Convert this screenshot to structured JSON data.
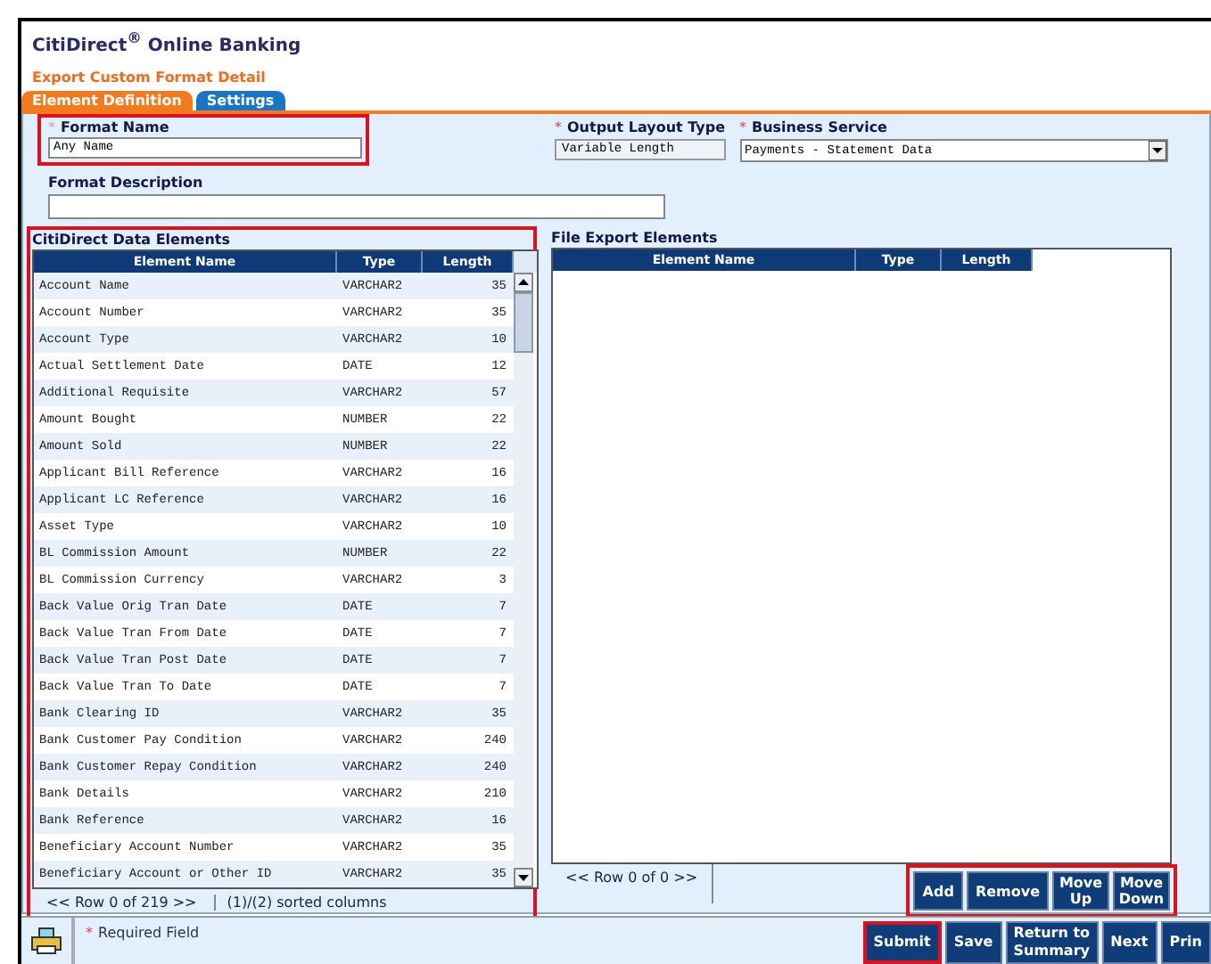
{
  "app_title": "CitiDirect$^{®}$ Online Banking",
  "page_title": "Export Custom Format Detail",
  "tabs": [
    {
      "label": "Element Definition",
      "selected": true
    },
    {
      "label": "Settings",
      "selected": false
    }
  ],
  "format_name": {
    "label": "Format Name",
    "required_mark": "*",
    "value": "Any Name",
    "highlighted": true
  },
  "output_layout_type": {
    "label": "Output Layout Type",
    "required_mark": "*",
    "value": "Variable Length"
  },
  "business_service": {
    "label": "Business Service",
    "required_mark": "*",
    "value": "Payments - Statement Data"
  },
  "format_description": {
    "label": "Format Description"
  },
  "data_elements": {
    "title": "CitiDirect Data Elements",
    "highlighted": true,
    "columns": [
      "Element Name",
      "Type",
      "Length"
    ],
    "rows": [
      [
        "Account Name",
        "VARCHAR2",
        "35"
      ],
      [
        "Account Number",
        "VARCHAR2",
        "35"
      ],
      [
        "Account Type",
        "VARCHAR2",
        "10"
      ],
      [
        "Actual Settlement Date",
        "DATE",
        "12"
      ],
      [
        "Additional Requisite",
        "VARCHAR2",
        "57"
      ],
      [
        "Amount Bought",
        "NUMBER",
        "22"
      ],
      [
        "Amount Sold",
        "NUMBER",
        "22"
      ],
      [
        "Applicant Bill Reference",
        "VARCHAR2",
        "16"
      ],
      [
        "Applicant LC Reference",
        "VARCHAR2",
        "16"
      ],
      [
        "Asset Type",
        "VARCHAR2",
        "10"
      ],
      [
        "BL Commission Amount",
        "NUMBER",
        "22"
      ],
      [
        "BL Commission Currency",
        "VARCHAR2",
        "3"
      ],
      [
        "Back Value Orig Tran Date",
        "DATE",
        "7"
      ],
      [
        "Back Value Tran From Date",
        "DATE",
        "7"
      ],
      [
        "Back Value Tran Post Date",
        "DATE",
        "7"
      ],
      [
        "Back Value Tran To Date",
        "DATE",
        "7"
      ],
      [
        "Bank Clearing ID",
        "VARCHAR2",
        "35"
      ],
      [
        "Bank Customer Pay Condition",
        "VARCHAR2",
        "240"
      ],
      [
        "Bank Customer Repay Condition",
        "VARCHAR2",
        "240"
      ],
      [
        "Bank Details",
        "VARCHAR2",
        "210"
      ],
      [
        "Bank Reference",
        "VARCHAR2",
        "16"
      ],
      [
        "Beneficiary Account Number",
        "VARCHAR2",
        "35"
      ],
      [
        "Beneficiary Account or Other ID",
        "VARCHAR2",
        "35"
      ]
    ],
    "pager": "<< Row 0 of 219 >>",
    "sort_info": "(1)/(2) sorted columns"
  },
  "export_elements": {
    "title": "File Export Elements",
    "columns": [
      "Element Name",
      "Type",
      "Length"
    ],
    "pager": "<< Row 0 of 0 >>",
    "buttons": {
      "highlighted": true,
      "items": [
        {
          "label": "Add"
        },
        {
          "label": "Remove"
        },
        {
          "label": "Move Up"
        },
        {
          "label": "Move Down"
        }
      ]
    }
  },
  "footer": {
    "required_note": {
      "mark": "*",
      "text": "Required Field"
    },
    "buttons": [
      {
        "label": "Submit",
        "highlighted": true
      },
      {
        "label": "Save",
        "highlighted": false
      },
      {
        "label": "Return to Summary",
        "highlighted": false
      },
      {
        "label": "Next",
        "highlighted": false
      },
      {
        "label": "Prin",
        "highlighted": false
      }
    ]
  }
}
